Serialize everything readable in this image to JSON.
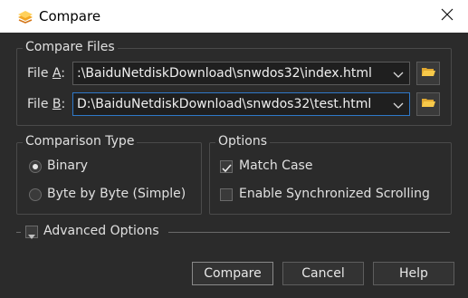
{
  "window": {
    "title": "Compare"
  },
  "files": {
    "legend": "Compare Files",
    "file_a": {
      "label": "File A:",
      "value": ":\\BaiduNetdiskDownload\\snwdos32\\index.html"
    },
    "file_b": {
      "label": "File B:",
      "value": "D:\\BaiduNetdiskDownload\\snwdos32\\test.html"
    }
  },
  "comparison": {
    "legend": "Comparison Type",
    "options": [
      {
        "label": "Binary",
        "selected": true
      },
      {
        "label": "Byte by Byte (Simple)",
        "selected": false
      }
    ]
  },
  "options": {
    "legend": "Options",
    "items": [
      {
        "label": "Match Case",
        "checked": true
      },
      {
        "label": "Enable Synchronized Scrolling",
        "checked": false
      }
    ]
  },
  "advanced": {
    "label": "Advanced Options"
  },
  "buttons": {
    "compare": "Compare",
    "cancel": "Cancel",
    "help": "Help"
  }
}
